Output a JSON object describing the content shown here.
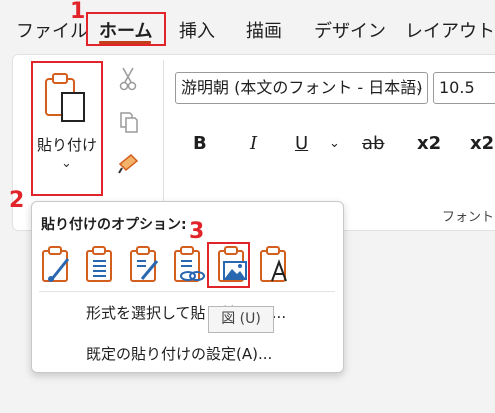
{
  "tabs": [
    {
      "label": "ファイル"
    },
    {
      "label": "ホーム"
    },
    {
      "label": "挿入"
    },
    {
      "label": "描画"
    },
    {
      "label": "デザイン"
    },
    {
      "label": "レイアウト"
    }
  ],
  "steps": [
    "1",
    "2",
    "3"
  ],
  "clipboard": {
    "paste_label": "貼り付け"
  },
  "font": {
    "name": "游明朝 (本文のフォント - 日本語)",
    "size": "10.5"
  },
  "format_buttons": [
    "B",
    "I",
    "U",
    "ab",
    "x2",
    "x2"
  ],
  "font_group_label": "フォント",
  "paste_options": {
    "title": "貼り付けのオプション:",
    "menu": [
      "形式を選択して貼り付け(S)...",
      "既定の貼り付けの設定(A)..."
    ],
    "tooltip": "図 (U)"
  },
  "colors": {
    "accent": "#e0242a",
    "tab_underline": "#c43e1c",
    "icon_orange": "#d35f1f",
    "icon_blue": "#2a67b1"
  }
}
